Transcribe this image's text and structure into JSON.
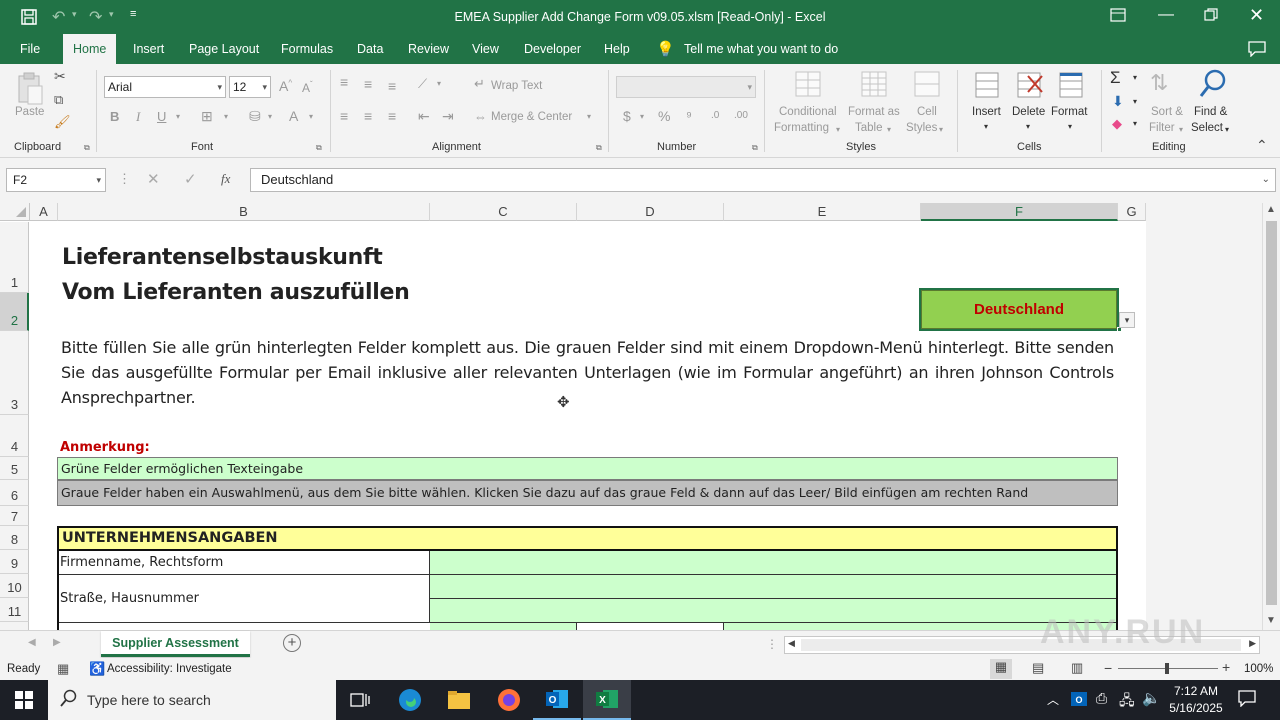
{
  "window": {
    "title": "EMEA Supplier Add Change Form v09.05.xlsm  [Read-Only]  -  Excel"
  },
  "menu": {
    "tabs": [
      "File",
      "Home",
      "Insert",
      "Page Layout",
      "Formulas",
      "Data",
      "Review",
      "View",
      "Developer",
      "Help"
    ],
    "active": "Home",
    "tell_me": "Tell me what you want to do"
  },
  "ribbon": {
    "clipboard": {
      "paste": "Paste",
      "group": "Clipboard"
    },
    "font": {
      "name": "Arial",
      "size": "12",
      "group": "Font"
    },
    "alignment": {
      "wrap": "Wrap Text",
      "merge": "Merge & Center",
      "group": "Alignment"
    },
    "number": {
      "group": "Number"
    },
    "styles": {
      "cond1": "Conditional",
      "cond2": "Formatting",
      "fmt1": "Format as",
      "fmt2": "Table",
      "cell1": "Cell",
      "cell2": "Styles",
      "group": "Styles"
    },
    "cells": {
      "insert": "Insert",
      "delete": "Delete",
      "format": "Format",
      "group": "Cells"
    },
    "editing": {
      "sort1": "Sort &",
      "sort2": "Filter",
      "find1": "Find &",
      "find2": "Select",
      "group": "Editing"
    }
  },
  "formula_bar": {
    "name_box": "F2",
    "fx": "fx",
    "content": "Deutschland"
  },
  "columns": [
    "A",
    "B",
    "C",
    "D",
    "E",
    "F",
    "G"
  ],
  "rows": [
    "1",
    "2",
    "3",
    "4",
    "5",
    "6",
    "7",
    "8",
    "9",
    "10",
    "11"
  ],
  "sheet": {
    "title1": "Lieferantenselbstauskunft",
    "title2": "Vom Lieferanten auszufüllen",
    "country": "Deutschland",
    "intro": "Bitte füllen Sie alle grün hinterlegten Felder komplett aus. Die grauen Felder sind mit einem Dropdown-Menü hinterlegt. Bitte senden Sie das ausgefüllte Formular per Email inklusive aller relevanten Unterlagen (wie im Formular angeführt) an ihren Johnson Controls Ansprechpartner.",
    "note_label": "Anmerkung:",
    "note_green": "Grüne Felder ermöglichen Texteingabe",
    "note_grey": "Graue Felder haben ein Auswahlmenü, aus dem Sie bitte wählen. Klicken Sie dazu auf das graue Feld & dann auf das Leer/ Bild einfügen am rechten Rand",
    "section_header": "UNTERNEHMENSANGABEN",
    "field_company": "Firmenname, Rechtsform",
    "field_street": "Straße, Hausnummer"
  },
  "sheet_tabs": {
    "active": "Supplier Assessment"
  },
  "status": {
    "ready": "Ready",
    "accessibility": "Accessibility: Investigate",
    "zoom": "100%"
  },
  "taskbar": {
    "search_placeholder": "Type here to search",
    "time": "7:12 AM",
    "date": "5/16/2025"
  },
  "watermark": "ANY.RUN",
  "colors": {
    "excel_green": "#217346",
    "field_green": "#ccffcc",
    "field_grey": "#bfbfbf",
    "country_green": "#92d050",
    "country_text": "#c00000",
    "section_yellow": "#ffff99",
    "note_red": "#c00000"
  }
}
